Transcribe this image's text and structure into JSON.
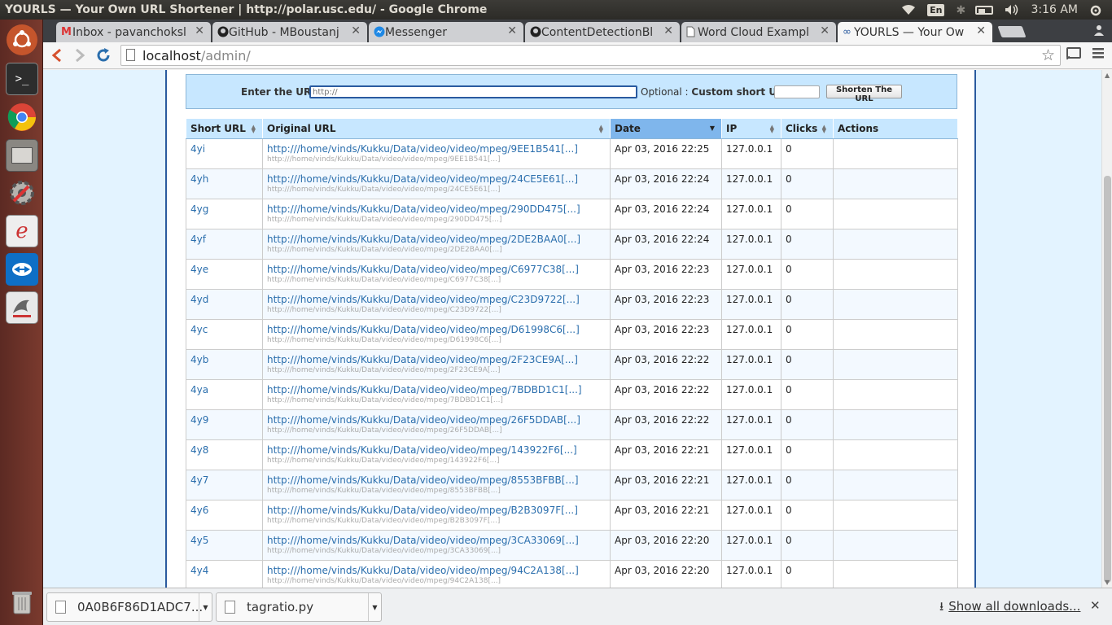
{
  "window": {
    "title": "YOURLS — Your Own URL Shortener | http://polar.usc.edu/ - Google Chrome",
    "keyboard_layout": "En",
    "time": "3:16 AM"
  },
  "tabs": [
    {
      "label": "Inbox - pavanchoksl",
      "icon": "gmail-icon",
      "active": false
    },
    {
      "label": "GitHub - MBoustanj",
      "icon": "github-icon",
      "active": false
    },
    {
      "label": "Messenger",
      "icon": "messenger-icon",
      "active": false
    },
    {
      "label": "ContentDetectionBl",
      "icon": "github-icon",
      "active": false
    },
    {
      "label": "Word Cloud Exampl",
      "icon": "document-icon",
      "active": false
    },
    {
      "label": "YOURLS — Your Ow",
      "icon": "link-icon",
      "active": true
    }
  ],
  "address_bar": {
    "host": "localhost",
    "path": "/admin/"
  },
  "new_url_form": {
    "enter_label": "Enter the URL:",
    "url_placeholder": "http://",
    "optional_label": "Optional : ",
    "custom_label": "Custom short URL:",
    "submit_label": "Shorten The URL"
  },
  "table": {
    "columns": [
      "Short URL",
      "Original URL",
      "Date",
      "IP",
      "Clicks",
      "Actions"
    ],
    "sorted_column": "Date",
    "rows": [
      {
        "short": "4yi",
        "title": "http:///home/vinds/Kukku/Data/video/video/mpeg/9EE1B541[...]",
        "url": "http:///home/vinds/Kukku/Data/video/video/mpeg/9EE1B541[...]",
        "date": "Apr 03, 2016 22:25",
        "ip": "127.0.0.1",
        "clicks": "0"
      },
      {
        "short": "4yh",
        "title": "http:///home/vinds/Kukku/Data/video/video/mpeg/24CE5E61[...]",
        "url": "http:///home/vinds/Kukku/Data/video/video/mpeg/24CE5E61[...]",
        "date": "Apr 03, 2016 22:24",
        "ip": "127.0.0.1",
        "clicks": "0"
      },
      {
        "short": "4yg",
        "title": "http:///home/vinds/Kukku/Data/video/video/mpeg/290DD475[...]",
        "url": "http:///home/vinds/Kukku/Data/video/video/mpeg/290DD475[...]",
        "date": "Apr 03, 2016 22:24",
        "ip": "127.0.0.1",
        "clicks": "0"
      },
      {
        "short": "4yf",
        "title": "http:///home/vinds/Kukku/Data/video/video/mpeg/2DE2BAA0[...]",
        "url": "http:///home/vinds/Kukku/Data/video/video/mpeg/2DE2BAA0[...]",
        "date": "Apr 03, 2016 22:24",
        "ip": "127.0.0.1",
        "clicks": "0"
      },
      {
        "short": "4ye",
        "title": "http:///home/vinds/Kukku/Data/video/video/mpeg/C6977C38[...]",
        "url": "http:///home/vinds/Kukku/Data/video/video/mpeg/C6977C38[...]",
        "date": "Apr 03, 2016 22:23",
        "ip": "127.0.0.1",
        "clicks": "0"
      },
      {
        "short": "4yd",
        "title": "http:///home/vinds/Kukku/Data/video/video/mpeg/C23D9722[...]",
        "url": "http:///home/vinds/Kukku/Data/video/video/mpeg/C23D9722[...]",
        "date": "Apr 03, 2016 22:23",
        "ip": "127.0.0.1",
        "clicks": "0"
      },
      {
        "short": "4yc",
        "title": "http:///home/vinds/Kukku/Data/video/video/mpeg/D61998C6[...]",
        "url": "http:///home/vinds/Kukku/Data/video/video/mpeg/D61998C6[...]",
        "date": "Apr 03, 2016 22:23",
        "ip": "127.0.0.1",
        "clicks": "0"
      },
      {
        "short": "4yb",
        "title": "http:///home/vinds/Kukku/Data/video/video/mpeg/2F23CE9A[...]",
        "url": "http:///home/vinds/Kukku/Data/video/video/mpeg/2F23CE9A[...]",
        "date": "Apr 03, 2016 22:22",
        "ip": "127.0.0.1",
        "clicks": "0"
      },
      {
        "short": "4ya",
        "title": "http:///home/vinds/Kukku/Data/video/video/mpeg/7BDBD1C1[...]",
        "url": "http:///home/vinds/Kukku/Data/video/video/mpeg/7BDBD1C1[...]",
        "date": "Apr 03, 2016 22:22",
        "ip": "127.0.0.1",
        "clicks": "0"
      },
      {
        "short": "4y9",
        "title": "http:///home/vinds/Kukku/Data/video/video/mpeg/26F5DDAB[...]",
        "url": "http:///home/vinds/Kukku/Data/video/video/mpeg/26F5DDAB[...]",
        "date": "Apr 03, 2016 22:22",
        "ip": "127.0.0.1",
        "clicks": "0"
      },
      {
        "short": "4y8",
        "title": "http:///home/vinds/Kukku/Data/video/video/mpeg/143922F6[...]",
        "url": "http:///home/vinds/Kukku/Data/video/video/mpeg/143922F6[...]",
        "date": "Apr 03, 2016 22:21",
        "ip": "127.0.0.1",
        "clicks": "0"
      },
      {
        "short": "4y7",
        "title": "http:///home/vinds/Kukku/Data/video/video/mpeg/8553BFBB[...]",
        "url": "http:///home/vinds/Kukku/Data/video/video/mpeg/8553BFBB[...]",
        "date": "Apr 03, 2016 22:21",
        "ip": "127.0.0.1",
        "clicks": "0"
      },
      {
        "short": "4y6",
        "title": "http:///home/vinds/Kukku/Data/video/video/mpeg/B2B3097F[...]",
        "url": "http:///home/vinds/Kukku/Data/video/video/mpeg/B2B3097F[...]",
        "date": "Apr 03, 2016 22:21",
        "ip": "127.0.0.1",
        "clicks": "0"
      },
      {
        "short": "4y5",
        "title": "http:///home/vinds/Kukku/Data/video/video/mpeg/3CA33069[...]",
        "url": "http:///home/vinds/Kukku/Data/video/video/mpeg/3CA33069[...]",
        "date": "Apr 03, 2016 22:20",
        "ip": "127.0.0.1",
        "clicks": "0"
      },
      {
        "short": "4y4",
        "title": "http:///home/vinds/Kukku/Data/video/video/mpeg/94C2A138[...]",
        "url": "http:///home/vinds/Kukku/Data/video/video/mpeg/94C2A138[...]",
        "date": "Apr 03, 2016 22:20",
        "ip": "127.0.0.1",
        "clicks": "0"
      }
    ]
  },
  "downloads": {
    "items": [
      "0A0B6F86D1ADC7...",
      "tagratio.py"
    ],
    "show_all_label": "Show all downloads..."
  },
  "colors": {
    "accent": "#2a5a9f",
    "header_bg": "#c7e7ff",
    "link": "#2a6ead",
    "launcher": "#7a3a2e"
  }
}
